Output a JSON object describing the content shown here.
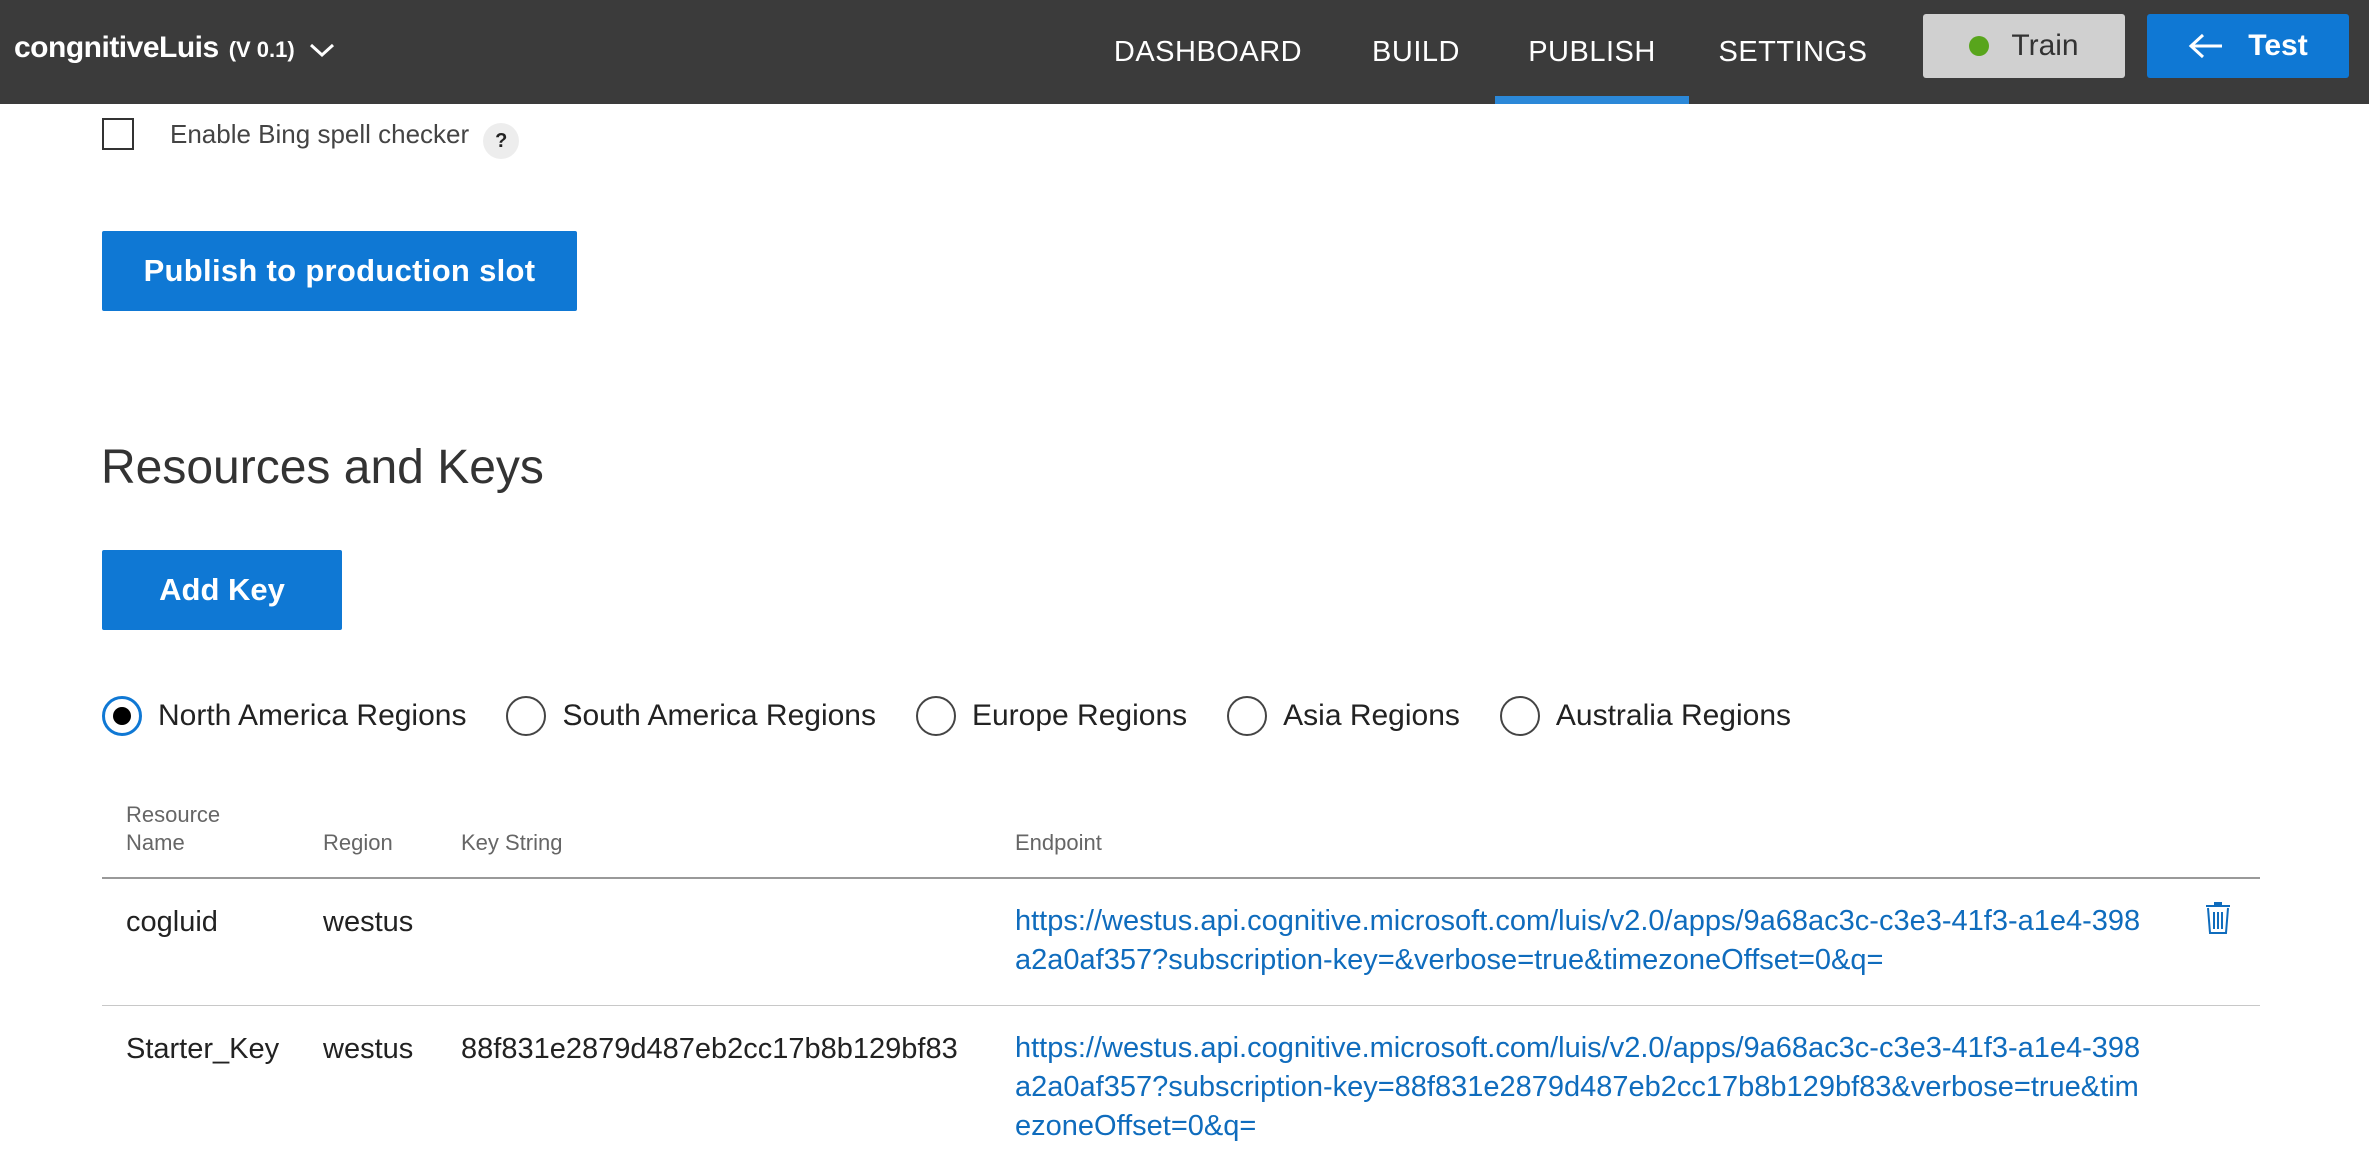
{
  "header": {
    "app_name": "congnitiveLuis",
    "app_version": "(V 0.1)",
    "nav": [
      {
        "label": "DASHBOARD"
      },
      {
        "label": "BUILD"
      },
      {
        "label": "PUBLISH",
        "active": true
      },
      {
        "label": "SETTINGS"
      }
    ],
    "train_label": "Train",
    "test_label": "Test"
  },
  "publish": {
    "spell_checker_label": "Enable Bing spell checker",
    "spell_checker_checked": false,
    "help_label": "?",
    "publish_button": "Publish to production slot"
  },
  "resources": {
    "title": "Resources and Keys",
    "add_key_button": "Add Key",
    "regions": [
      {
        "label": "North America Regions",
        "selected": true
      },
      {
        "label": "South America Regions",
        "selected": false
      },
      {
        "label": "Europe Regions",
        "selected": false
      },
      {
        "label": "Asia Regions",
        "selected": false
      },
      {
        "label": "Australia Regions",
        "selected": false
      }
    ],
    "columns": [
      "Resource Name",
      "Region",
      "Key String",
      "Endpoint"
    ],
    "rows": [
      {
        "name": "cogluid",
        "region": "westus",
        "key": "",
        "endpoint": "https://westus.api.cognitive.microsoft.com/luis/v2.0/apps/9a68ac3c-c3e3-41f3-a1e4-398a2a0af357?subscription-key=&verbose=true&timezoneOffset=0&q="
      },
      {
        "name": "Starter_Key",
        "region": "westus",
        "key": "88f831e2879d487eb2cc17b8b129bf83",
        "endpoint": "https://westus.api.cognitive.microsoft.com/luis/v2.0/apps/9a68ac3c-c3e3-41f3-a1e4-398a2a0af357?subscription-key=88f831e2879d487eb2cc17b8b129bf83&verbose=true&timezoneOffset=0&q="
      }
    ]
  },
  "colors": {
    "topbar": "#3b3b3b",
    "accent": "#0f78d4",
    "nav_underline": "#2b88d8",
    "train_status": "#58a51c",
    "link": "#0f6cbd"
  }
}
